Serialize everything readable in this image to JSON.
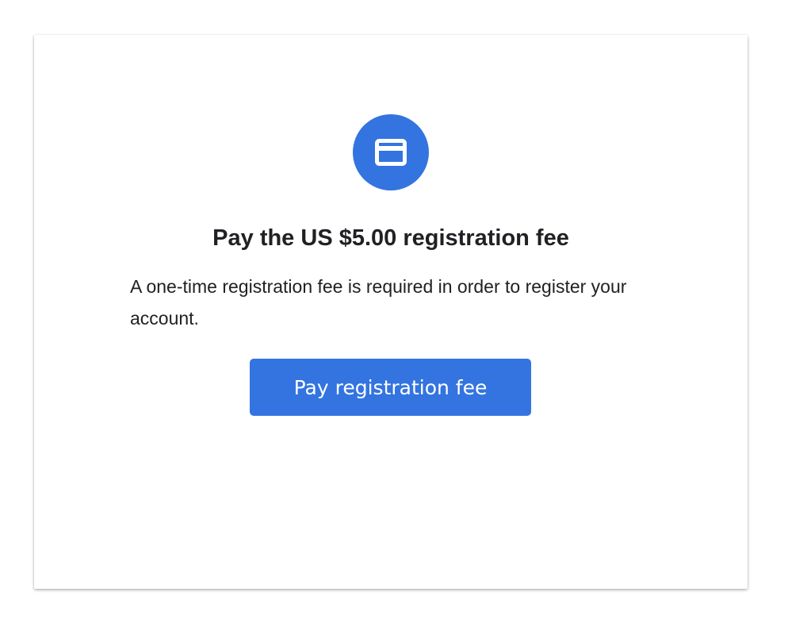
{
  "card": {
    "icon": "credit-card-icon",
    "title": "Pay the US $5.00 registration fee",
    "description": "A one-time registration fee is required in order to register your account.",
    "button_label": "Pay registration fee"
  },
  "colors": {
    "accent": "#3374e0",
    "text": "#202124",
    "background": "#ffffff"
  }
}
